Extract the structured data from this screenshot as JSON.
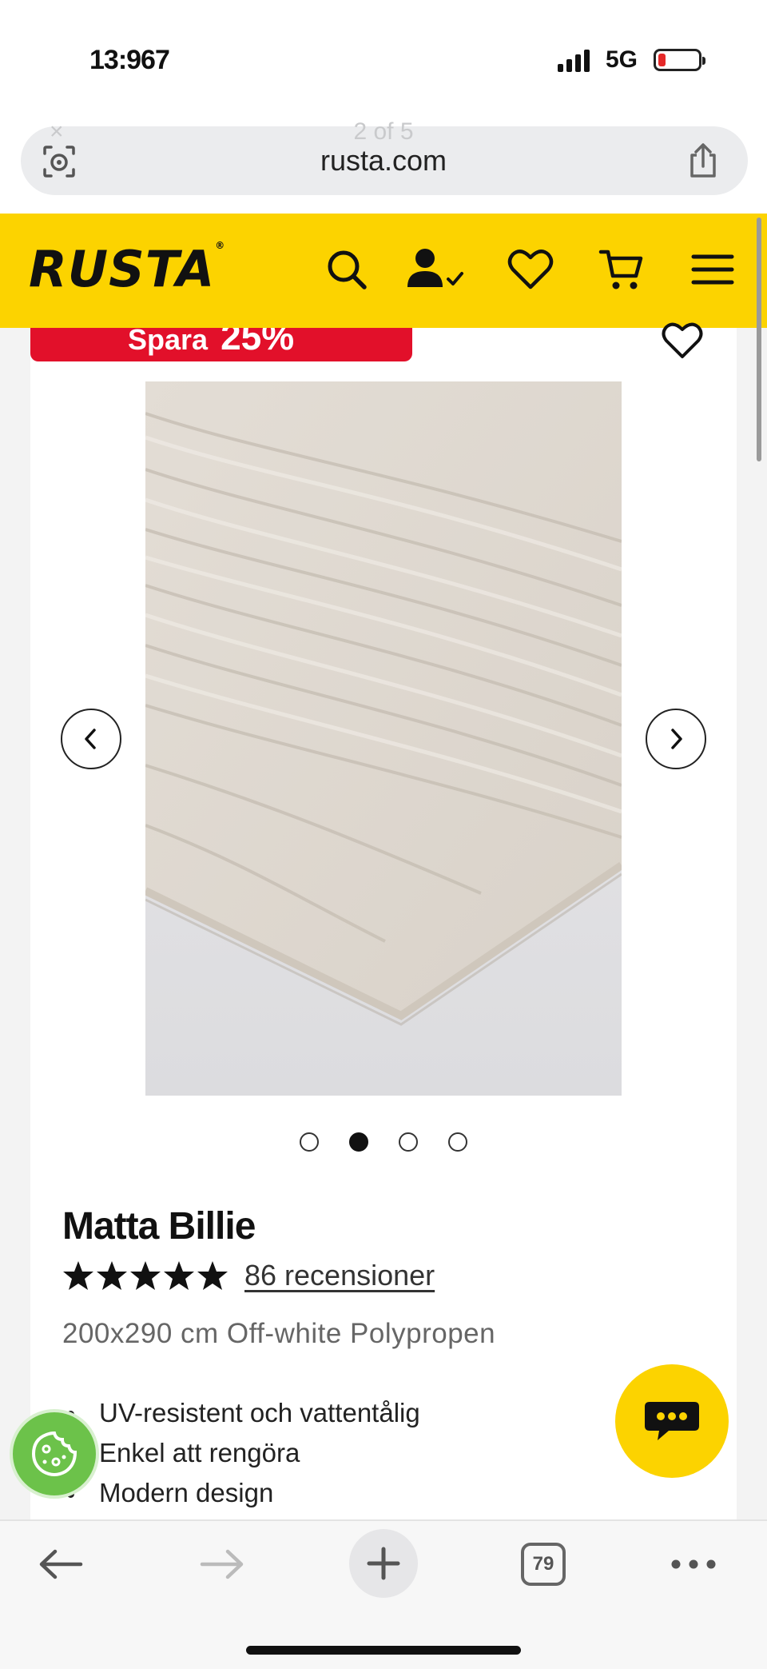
{
  "status_bar": {
    "time": "13:967",
    "network": "5G",
    "battery_color": "#e52929"
  },
  "browser": {
    "url": "rusta.com",
    "ghost_counter": "2 of 5",
    "ghost_close": "×",
    "tabs_count": "79"
  },
  "header": {
    "logo": "RUSTA",
    "logo_mark": "®",
    "background": "#fcd300",
    "icons": [
      "search-icon",
      "account-icon",
      "heart-icon",
      "cart-icon",
      "menu-icon"
    ]
  },
  "product": {
    "badge_label": "Spara",
    "badge_value": "25%",
    "badge_color": "#e2102a",
    "title": "Matta Billie",
    "rating": 5,
    "reviews_text": "86 recensioner",
    "subtitle": "200x290 cm Off-white Polypropen",
    "features": [
      "UV-resistent och vattentålig",
      "Enkel att rengöra",
      "Modern design"
    ],
    "gallery": {
      "current": 2,
      "total": 4
    }
  }
}
